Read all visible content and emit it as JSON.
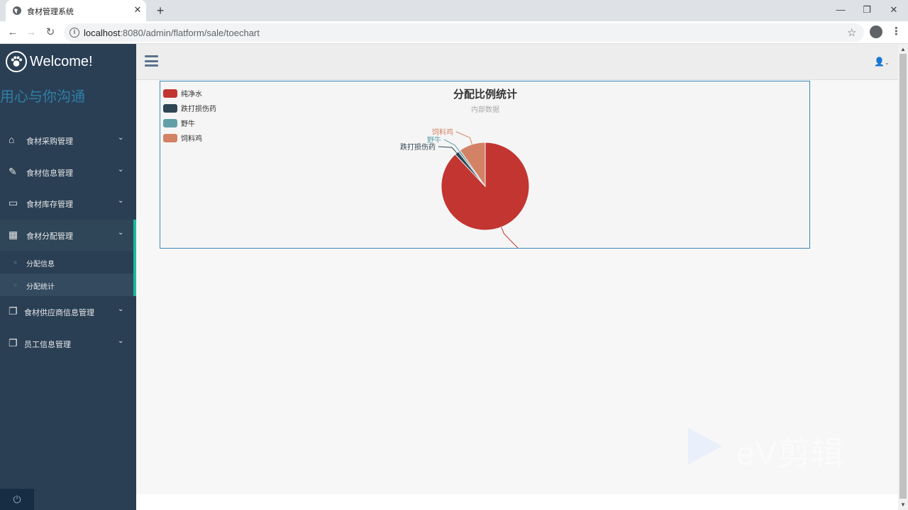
{
  "browser": {
    "tab_title": "食材管理系统",
    "url_host": "localhost",
    "url_path": ":8080/admin/flatform/sale/toechart"
  },
  "sidebar": {
    "brand": "Welcome!",
    "slogan": "用心与你沟通",
    "menu": [
      {
        "label": "食材采购管理",
        "icon": "home-icon"
      },
      {
        "label": "食材信息管理",
        "icon": "edit-icon"
      },
      {
        "label": "食材库存管理",
        "icon": "desktop-icon"
      },
      {
        "label": "食材分配管理",
        "icon": "table-icon"
      },
      {
        "label": "食材供应商信息管理",
        "icon": "copy-icon"
      },
      {
        "label": "员工信息管理",
        "icon": "copy-icon"
      }
    ],
    "submenu": [
      {
        "label": "分配信息"
      },
      {
        "label": "分配统计"
      }
    ]
  },
  "chart_data": {
    "type": "pie",
    "title": "分配比例统计",
    "subtitle": "内部数据",
    "legend_position": "top-left",
    "slices": [
      {
        "name": "纯净水",
        "value": 88,
        "color": "#c23531"
      },
      {
        "name": "跌打损伤药",
        "value": 1.5,
        "color": "#2f4554"
      },
      {
        "name": "野牛",
        "value": 0.8,
        "color": "#61a0a8"
      },
      {
        "name": "饲料鸡",
        "value": 9.7,
        "color": "#d48265"
      }
    ]
  },
  "watermark": {
    "text": "eV剪辑"
  }
}
